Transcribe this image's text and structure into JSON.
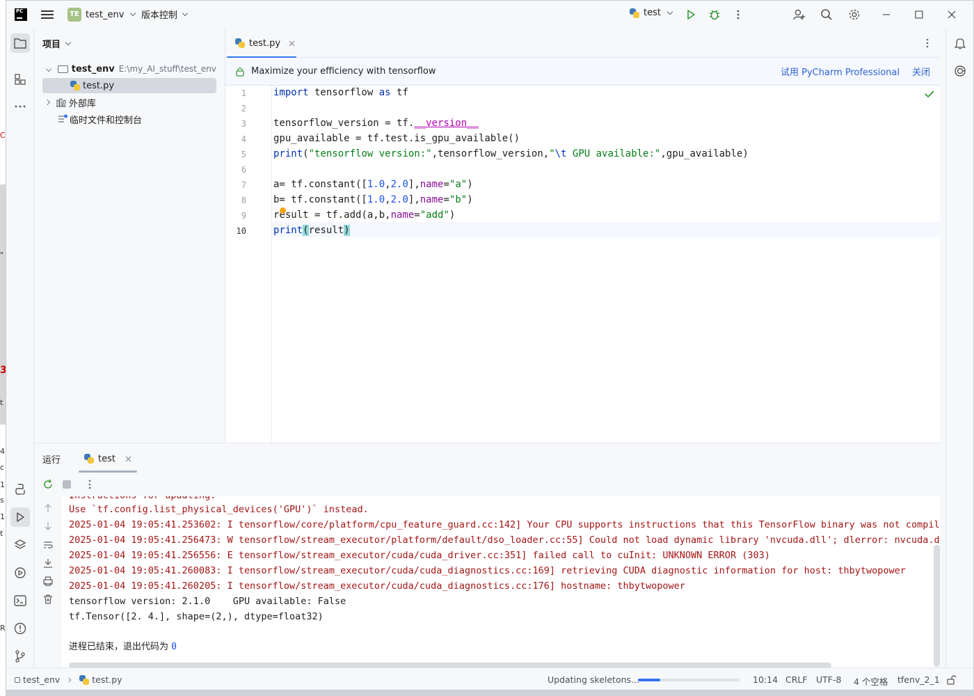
{
  "background_window": {
    "fragments": [
      "CO",
      "\"",
      "3",
      "t",
      "4",
      "c",
      "1",
      "s",
      "1",
      "t",
      "R"
    ]
  },
  "titlebar": {
    "app_logo": "PC",
    "menu_icon": "hamburger-icon",
    "project_badge": "TE",
    "project_name": "test_env",
    "vcs_label": "版本控制",
    "run_config": "test",
    "icons": [
      "run-icon",
      "debug-icon",
      "more-icon",
      "add-user-icon",
      "search-icon",
      "settings-icon"
    ],
    "window_controls": [
      "minimize",
      "maximize",
      "close"
    ]
  },
  "project_panel": {
    "title": "项目",
    "tree": [
      {
        "label": "test_env",
        "path": "E:\\my_AI_stuff\\test_env",
        "expanded": true,
        "type": "folder"
      },
      {
        "label": "test.py",
        "type": "python-file",
        "selected": true
      },
      {
        "label": "外部库",
        "expanded": false,
        "type": "library"
      },
      {
        "label": "临时文件和控制台",
        "type": "scratch"
      }
    ]
  },
  "editor": {
    "tab_label": "test.py",
    "banner": {
      "text": "Maximize your efficiency with tensorflow",
      "action": "试用 PyCharm Professional",
      "close": "关闭"
    },
    "line_numbers": [
      "1",
      "2",
      "3",
      "4",
      "5",
      "6",
      "7",
      "8",
      "9",
      "10"
    ],
    "current_line": "10",
    "status_icon": "check-icon"
  },
  "run_panel": {
    "title": "运行",
    "tab_label": "test",
    "console_lines": [
      {
        "text": "Instructions for updating:",
        "kind": "err"
      },
      {
        "text": "Use `tf.config.list_physical_devices('GPU')` instead.",
        "kind": "err"
      },
      {
        "text": "2025-01-04 19:05:41.253602: I tensorflow/core/platform/cpu_feature_guard.cc:142] Your CPU supports instructions that this TensorFlow binary was not compiled",
        "kind": "err"
      },
      {
        "text": "2025-01-04 19:05:41.256473: W tensorflow/stream_executor/platform/default/dso_loader.cc:55] Could not load dynamic library 'nvcuda.dll'; dlerror: nvcuda.dll",
        "kind": "err"
      },
      {
        "text": "2025-01-04 19:05:41.256556: E tensorflow/stream_executor/cuda/cuda_driver.cc:351] failed call to cuInit: UNKNOWN ERROR (303)",
        "kind": "err"
      },
      {
        "text": "2025-01-04 19:05:41.260083: I tensorflow/stream_executor/cuda/cuda_diagnostics.cc:169] retrieving CUDA diagnostic information for host: thbytwopower",
        "kind": "err"
      },
      {
        "text": "2025-01-04 19:05:41.260205: I tensorflow/stream_executor/cuda/cuda_diagnostics.cc:176] hostname: thbytwopower",
        "kind": "err"
      },
      {
        "text": "tensorflow version: 2.1.0    GPU available: False",
        "kind": "out"
      },
      {
        "text": "tf.Tensor([2. 4.], shape=(2,), dtype=float32)",
        "kind": "out"
      },
      {
        "text": "",
        "kind": "out"
      }
    ],
    "exit_text": "进程已结束，退出代码为 ",
    "exit_code": "0"
  },
  "statusbar": {
    "breadcrumb_project": "test_env",
    "breadcrumb_file": "test.py",
    "task": "Updating skeletons...",
    "task_progress": 0.22,
    "position": "10:14",
    "line_sep": "CRLF",
    "encoding": "UTF-8",
    "indent": "4 个空格",
    "interpreter": "tfenv_2_1"
  },
  "colors": {
    "accent": "#3574f0",
    "error_text": "#a31515",
    "keyword": "#0033b3",
    "string": "#067d17",
    "number": "#1750eb"
  }
}
